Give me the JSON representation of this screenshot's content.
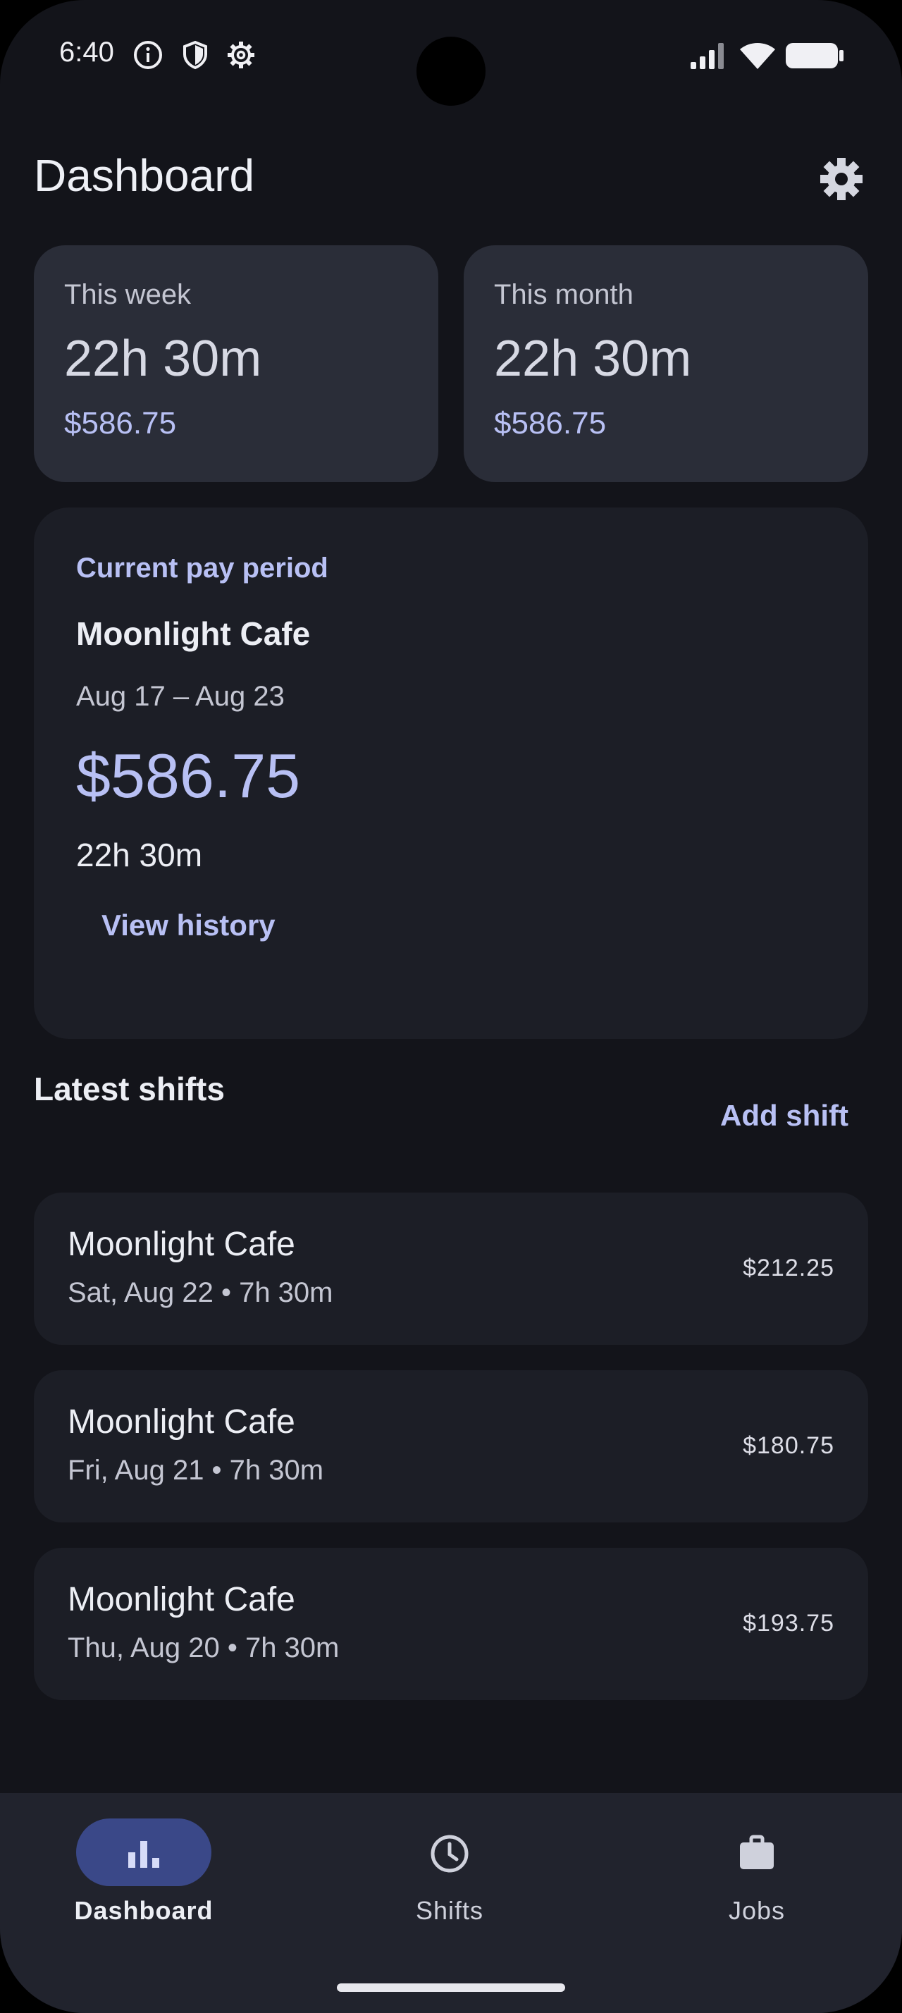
{
  "status_bar": {
    "time": "6:40",
    "left_icons": [
      "info-icon",
      "shield-icon",
      "gear-icon"
    ],
    "right_icons": [
      "cellular-signal-icon",
      "wifi-icon",
      "battery-icon"
    ]
  },
  "header": {
    "title": "Dashboard",
    "settings_icon": "gear-icon"
  },
  "summary": [
    {
      "label": "This week",
      "hours": "22h 30m",
      "amount": "$586.75"
    },
    {
      "label": "This month",
      "hours": "22h 30m",
      "amount": "$586.75"
    }
  ],
  "pay_period": {
    "label": "Current pay period",
    "job": "Moonlight Cafe",
    "range": "Aug 17 – Aug 23",
    "amount": "$586.75",
    "hours": "22h 30m",
    "history_button": "View history"
  },
  "latest_shifts": {
    "title": "Latest shifts",
    "add_button": "Add shift",
    "items": [
      {
        "job": "Moonlight Cafe",
        "meta": "Sat, Aug 22 • 7h 30m",
        "amount": "$212.25"
      },
      {
        "job": "Moonlight Cafe",
        "meta": "Fri, Aug 21 • 7h 30m",
        "amount": "$180.75"
      },
      {
        "job": "Moonlight Cafe",
        "meta": "Thu, Aug 20 • 7h 30m",
        "amount": "$193.75"
      }
    ]
  },
  "bottom_nav": [
    {
      "label": "Dashboard",
      "icon": "bar-chart-icon",
      "active": true
    },
    {
      "label": "Shifts",
      "icon": "clock-icon",
      "active": false
    },
    {
      "label": "Jobs",
      "icon": "briefcase-icon",
      "active": false
    }
  ],
  "colors": {
    "background": "#13141a",
    "card": "#1c1e26",
    "summary_card": "#2a2d38",
    "accent": "#b8c0f4",
    "nav_active": "#3a4888"
  }
}
